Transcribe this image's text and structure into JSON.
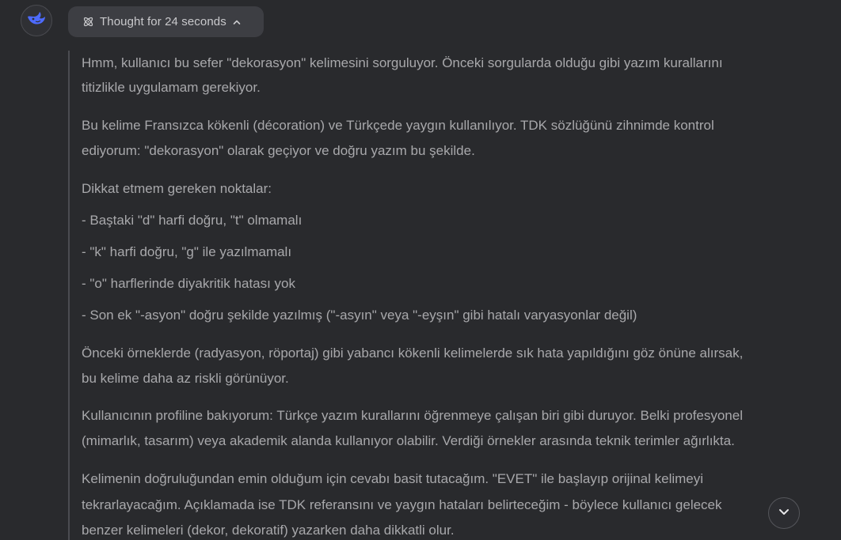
{
  "header": {
    "avatar_icon": "whale-logo-icon",
    "thought_label": "Thought for 24 seconds",
    "thought_icon": "atom-icon",
    "toggle_icon": "chevron-up-icon"
  },
  "thought": {
    "lines": [
      "Hmm, kullanıcı bu sefer \"dekorasyon\" kelimesini sorguluyor. Önceki sorgularda olduğu gibi yazım kurallarını",
      "titizlikle uygulamam gerekiyor.",
      "Bu kelime Fransızca kökenli (décoration) ve Türkçede yaygın kullanılıyor. TDK sözlüğünü zihnimde kontrol",
      "ediyorum: \"dekorasyon\" olarak geçiyor ve doğru yazım bu şekilde.",
      "Dikkat etmem gereken noktalar:",
      "- Baştaki \"d\" harfi doğru, \"t\" olmamalı",
      "- \"k\" harfi doğru, \"g\" ile yazılmamalı",
      "- \"o\" harflerinde diyakritik hatası yok",
      "- Son ek \"-asyon\" doğru şekilde yazılmış (\"-asyın\" veya \"-eyşın\" gibi hatalı varyasyonlar değil)",
      "Önceki örneklerde (radyasyon, röportaj) gibi yabancı kökenli kelimelerde sık hata yapıldığını göz önüne alırsak,",
      "bu kelime daha az riskli görünüyor.",
      "Kullanıcının profiline bakıyorum: Türkçe yazım kurallarını öğrenmeye çalışan biri gibi duruyor. Belki profesyonel",
      "(mimarlık, tasarım) veya akademik alanda kullanıyor olabilir. Verdiği örnekler arasında teknik terimler ağırlıkta.",
      "Kelimenin doğruluğundan emin olduğum için cevabı basit tutacağım. \"EVET\" ile başlayıp orijinal kelimeyi",
      "tekrarlayacağım. Açıklamada ise TDK referansını ve yaygın hataları belirteceğim - böylece kullanıcı gelecek",
      "benzer kelimeleri (dekor, dekoratif) yazarken daha dikkatli olur."
    ]
  },
  "scroll_button": {
    "icon": "chevron-down-icon"
  },
  "colors": {
    "background": "#292a2d",
    "text": "#a8a8ab",
    "pill": "#3d3e43",
    "accent": "#4d6bfe"
  }
}
